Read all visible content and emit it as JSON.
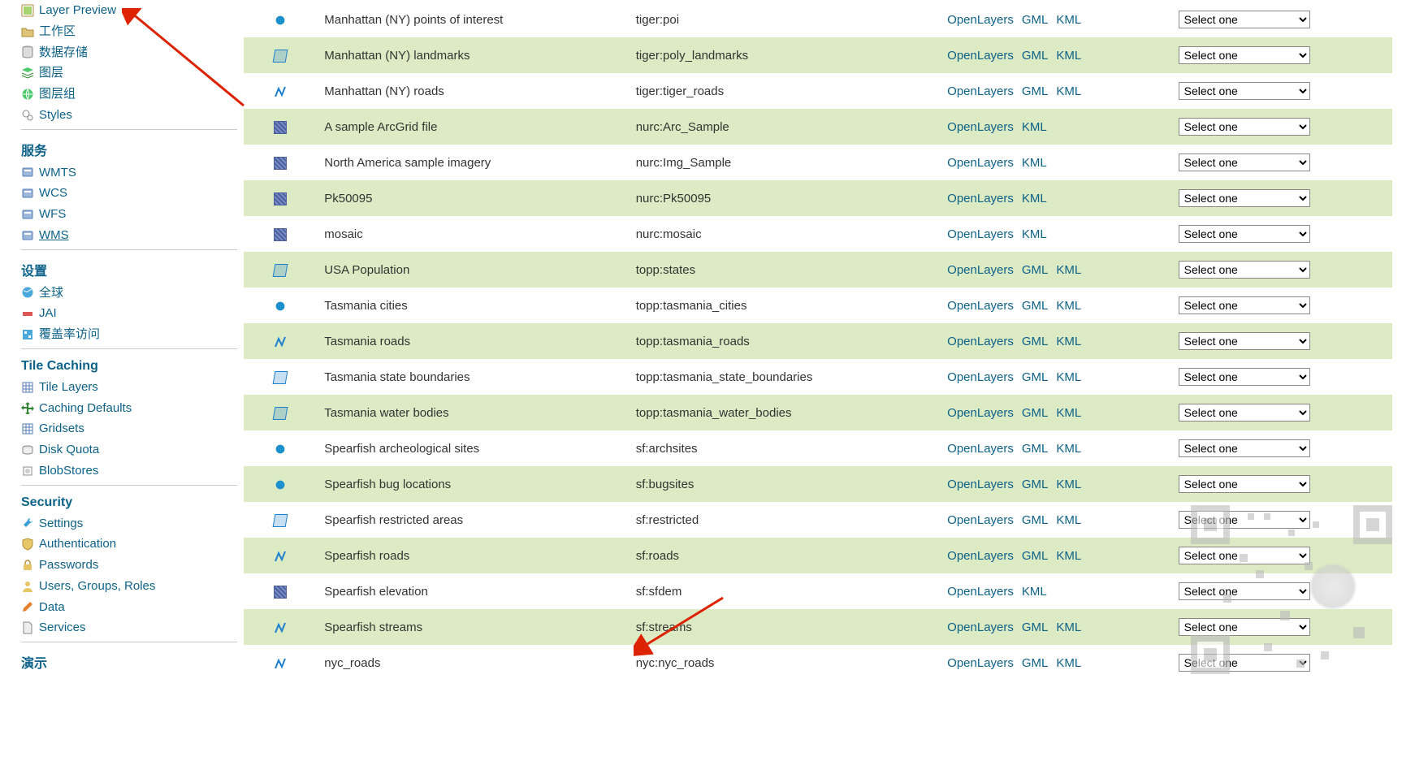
{
  "sidebar": {
    "data_group": [
      {
        "icon": "layerpreview",
        "label": "Layer Preview"
      },
      {
        "icon": "folder",
        "label": "工作区"
      },
      {
        "icon": "db",
        "label": "数据存储"
      },
      {
        "icon": "layers",
        "label": "图层"
      },
      {
        "icon": "globe",
        "label": "图层组"
      },
      {
        "icon": "style",
        "label": "Styles"
      }
    ],
    "services_head": "服务",
    "services": [
      {
        "icon": "svc",
        "label": "WMTS"
      },
      {
        "icon": "svc",
        "label": "WCS"
      },
      {
        "icon": "svc",
        "label": "WFS"
      },
      {
        "icon": "svc",
        "label": "WMS",
        "underline": true
      }
    ],
    "settings_head": "设置",
    "settings": [
      {
        "icon": "world",
        "label": "全球"
      },
      {
        "icon": "jai",
        "label": "JAI"
      },
      {
        "icon": "cov",
        "label": "覆盖率访问"
      }
    ],
    "tile_head": "Tile Caching",
    "tile": [
      {
        "icon": "grid",
        "label": "Tile Layers"
      },
      {
        "icon": "arrows",
        "label": "Caching Defaults"
      },
      {
        "icon": "grid",
        "label": "Gridsets"
      },
      {
        "icon": "disk",
        "label": "Disk Quota"
      },
      {
        "icon": "blob",
        "label": "BlobStores"
      }
    ],
    "security_head": "Security",
    "security": [
      {
        "icon": "wrench",
        "label": "Settings"
      },
      {
        "icon": "shield",
        "label": "Authentication"
      },
      {
        "icon": "lock",
        "label": "Passwords"
      },
      {
        "icon": "user",
        "label": "Users, Groups, Roles"
      },
      {
        "icon": "pencil",
        "label": "Data"
      },
      {
        "icon": "page",
        "label": "Services"
      }
    ],
    "demo_head": "演示"
  },
  "select_label": "Select one",
  "format_labels": {
    "ol": "OpenLayers",
    "gml": "GML",
    "kml": "KML"
  },
  "rows": [
    {
      "type": "point",
      "title": "Manhattan (NY) points of interest",
      "name": "tiger:poi",
      "fmt": [
        "ol",
        "gml",
        "kml"
      ]
    },
    {
      "type": "poly",
      "title": "Manhattan (NY) landmarks",
      "name": "tiger:poly_landmarks",
      "fmt": [
        "ol",
        "gml",
        "kml"
      ],
      "alt": true
    },
    {
      "type": "line",
      "title": "Manhattan (NY) roads",
      "name": "tiger:tiger_roads",
      "fmt": [
        "ol",
        "gml",
        "kml"
      ]
    },
    {
      "type": "raster",
      "title": "A sample ArcGrid file",
      "name": "nurc:Arc_Sample",
      "fmt": [
        "ol",
        "kml"
      ],
      "alt": true
    },
    {
      "type": "raster",
      "title": "North America sample imagery",
      "name": "nurc:Img_Sample",
      "fmt": [
        "ol",
        "kml"
      ]
    },
    {
      "type": "raster",
      "title": "Pk50095",
      "name": "nurc:Pk50095",
      "fmt": [
        "ol",
        "kml"
      ],
      "alt": true
    },
    {
      "type": "raster",
      "title": "mosaic",
      "name": "nurc:mosaic",
      "fmt": [
        "ol",
        "kml"
      ]
    },
    {
      "type": "poly",
      "title": "USA Population",
      "name": "topp:states",
      "fmt": [
        "ol",
        "gml",
        "kml"
      ],
      "alt": true
    },
    {
      "type": "point",
      "title": "Tasmania cities",
      "name": "topp:tasmania_cities",
      "fmt": [
        "ol",
        "gml",
        "kml"
      ]
    },
    {
      "type": "line",
      "title": "Tasmania roads",
      "name": "topp:tasmania_roads",
      "fmt": [
        "ol",
        "gml",
        "kml"
      ],
      "alt": true
    },
    {
      "type": "poly",
      "title": "Tasmania state boundaries",
      "name": "topp:tasmania_state_boundaries",
      "fmt": [
        "ol",
        "gml",
        "kml"
      ]
    },
    {
      "type": "poly",
      "title": "Tasmania water bodies",
      "name": "topp:tasmania_water_bodies",
      "fmt": [
        "ol",
        "gml",
        "kml"
      ],
      "alt": true
    },
    {
      "type": "point",
      "title": "Spearfish archeological sites",
      "name": "sf:archsites",
      "fmt": [
        "ol",
        "gml",
        "kml"
      ]
    },
    {
      "type": "point",
      "title": "Spearfish bug locations",
      "name": "sf:bugsites",
      "fmt": [
        "ol",
        "gml",
        "kml"
      ],
      "alt": true
    },
    {
      "type": "poly",
      "title": "Spearfish restricted areas",
      "name": "sf:restricted",
      "fmt": [
        "ol",
        "gml",
        "kml"
      ]
    },
    {
      "type": "line",
      "title": "Spearfish roads",
      "name": "sf:roads",
      "fmt": [
        "ol",
        "gml",
        "kml"
      ],
      "alt": true
    },
    {
      "type": "raster",
      "title": "Spearfish elevation",
      "name": "sf:sfdem",
      "fmt": [
        "ol",
        "kml"
      ]
    },
    {
      "type": "line",
      "title": "Spearfish streams",
      "name": "sf:streams",
      "fmt": [
        "ol",
        "gml",
        "kml"
      ],
      "alt": true
    },
    {
      "type": "line",
      "title": "nyc_roads",
      "name": "nyc:nyc_roads",
      "fmt": [
        "ol",
        "gml",
        "kml"
      ]
    }
  ]
}
